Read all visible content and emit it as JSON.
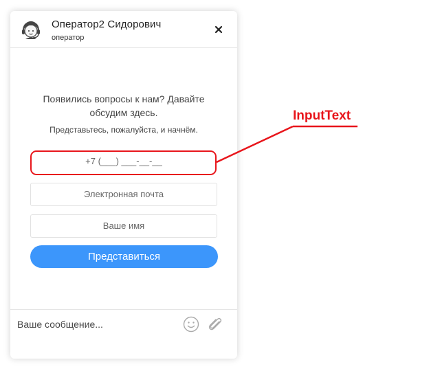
{
  "header": {
    "operator_name": "Оператор2 Сидорович",
    "operator_role": "оператор",
    "avatar_icon": "operator-headset-icon",
    "close_icon": "close-icon"
  },
  "intro": {
    "main": "Появились вопросы к нам? Давайте обсудим здесь.",
    "sub": "Представьтесь, пожалуйста, и начнём."
  },
  "form": {
    "phone_placeholder": "+7 (___) ___-__-__",
    "email_placeholder": "Электронная почта",
    "name_placeholder": "Ваше имя",
    "submit_label": "Представиться"
  },
  "footer": {
    "message_placeholder": "Ваше сообщение...",
    "emoji_icon": "smile-icon",
    "attach_icon": "paperclip-icon"
  },
  "annotation": {
    "label": "InputText",
    "color": "#e8151b"
  },
  "colors": {
    "accent": "#3c96fb"
  }
}
